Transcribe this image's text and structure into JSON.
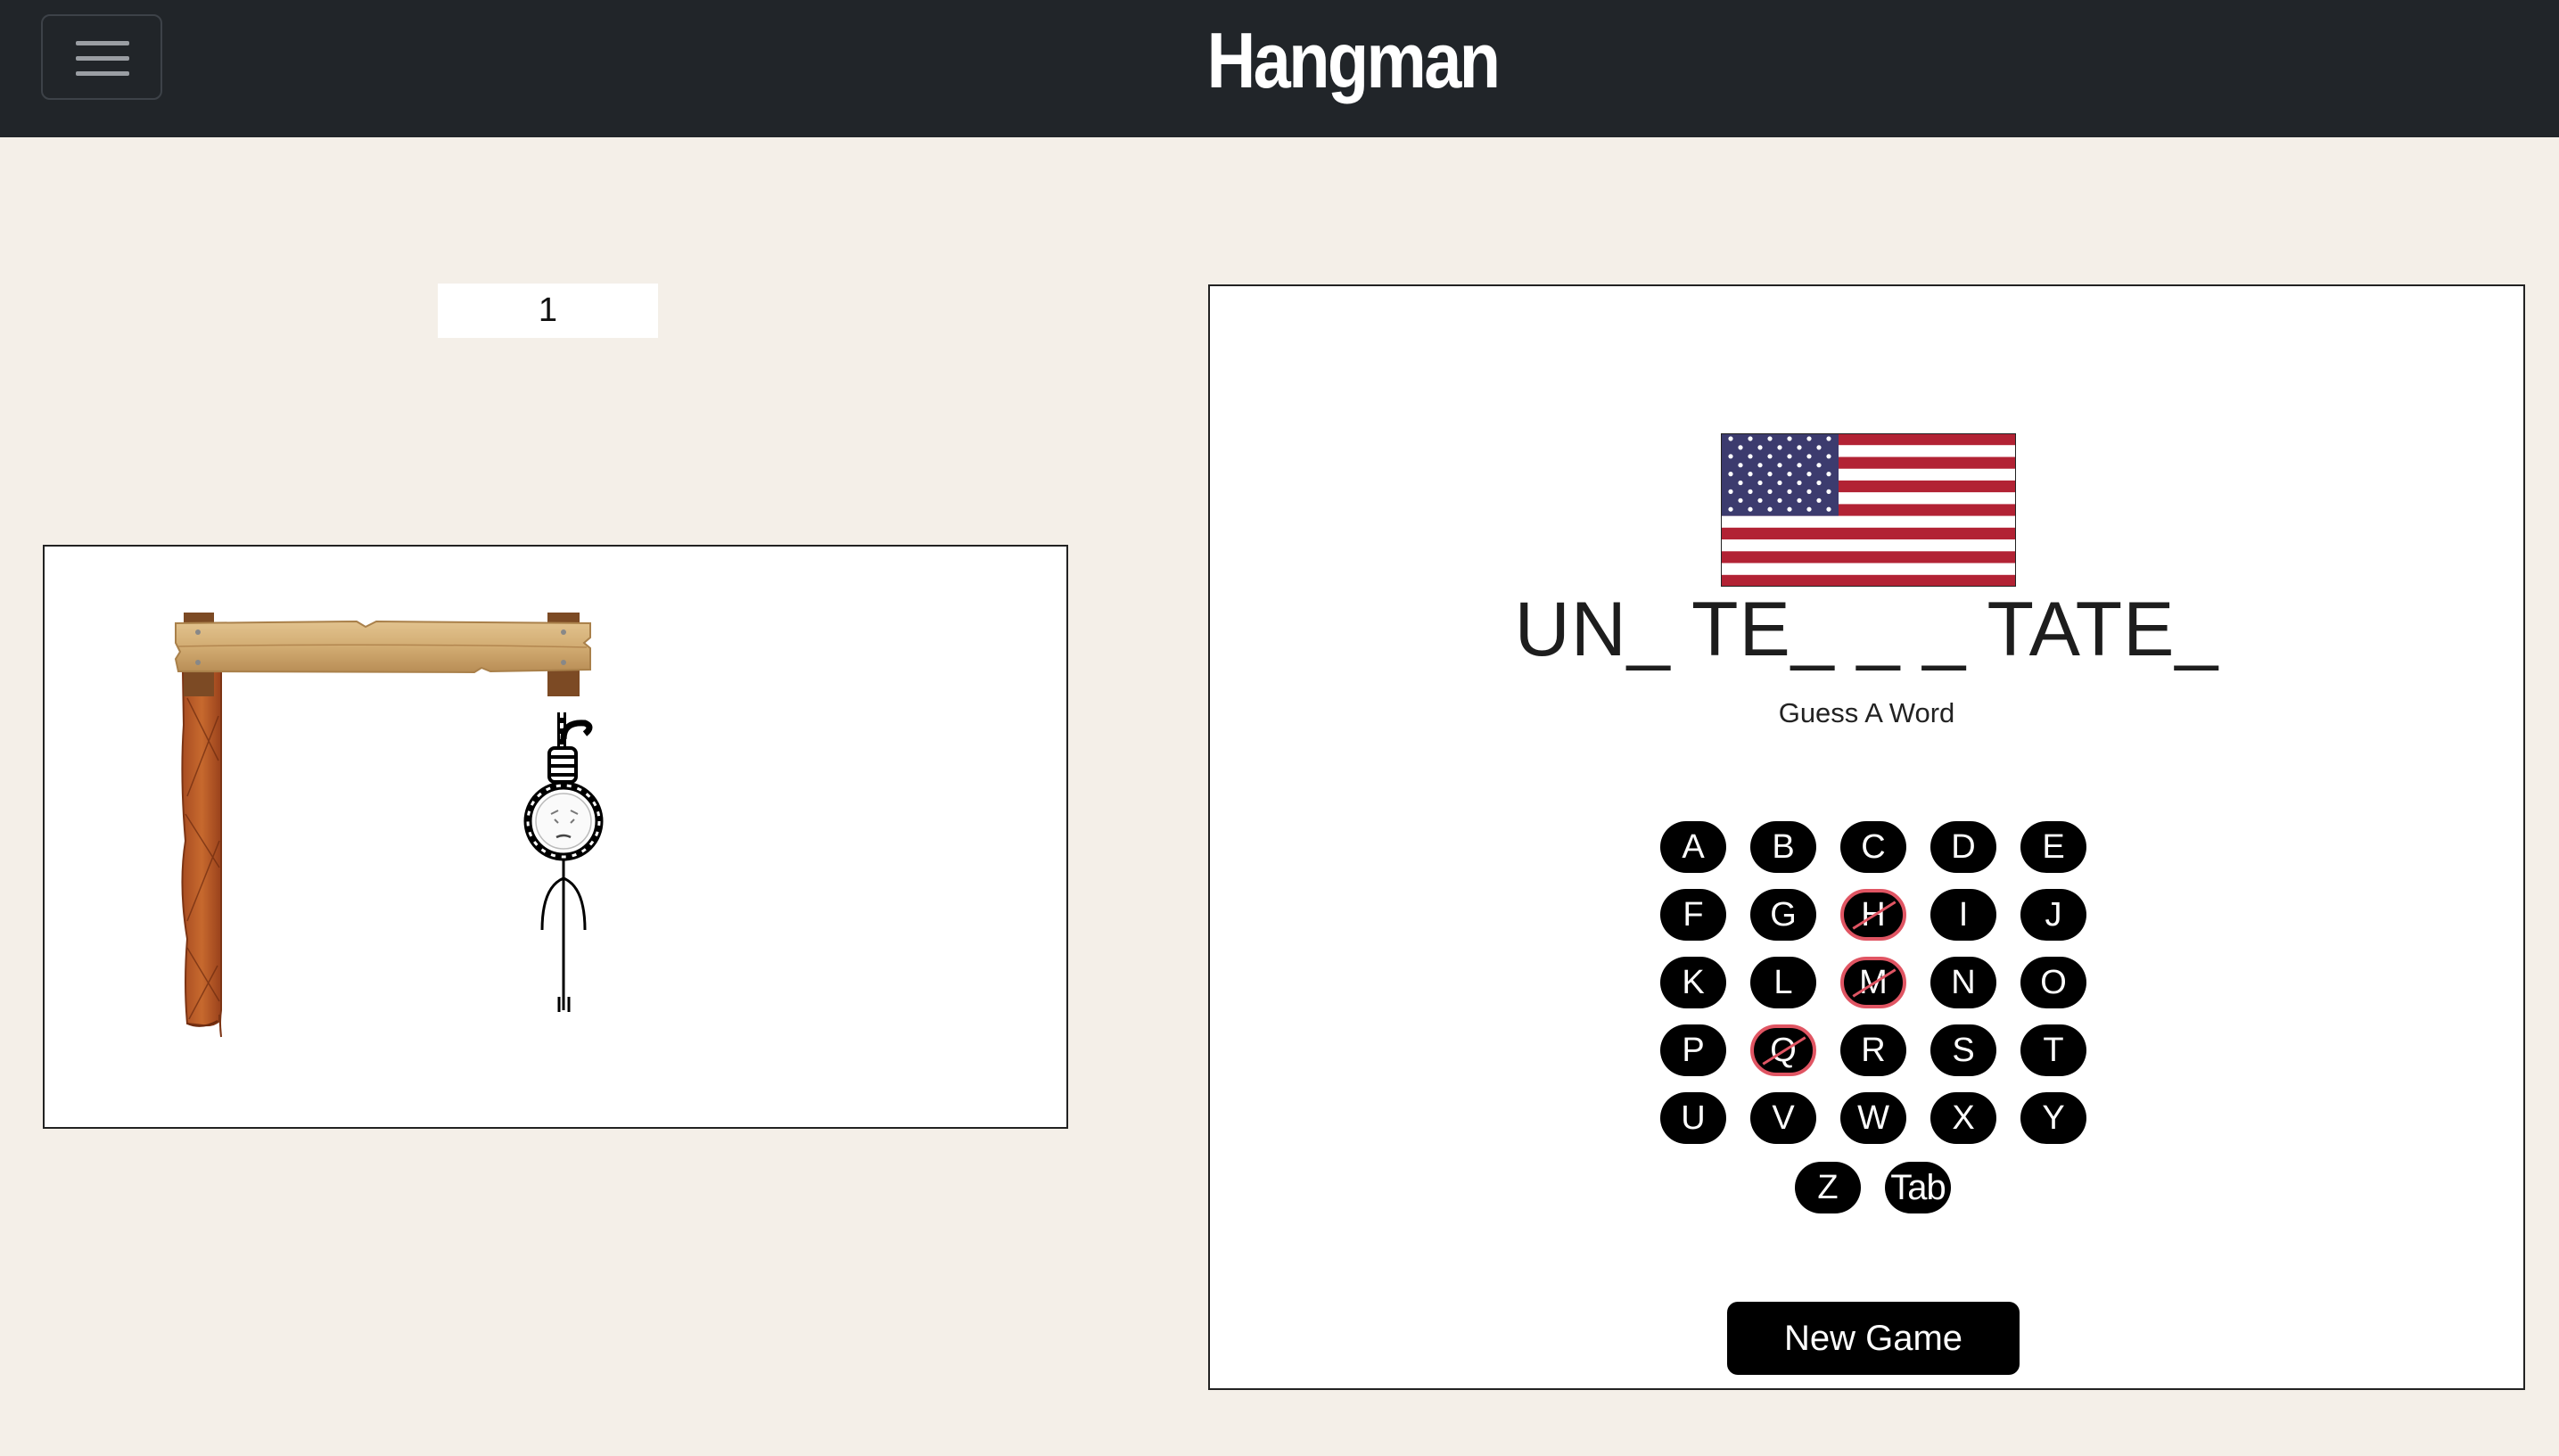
{
  "header": {
    "title": "Hangman",
    "menu_icon": "hamburger-menu-icon"
  },
  "game": {
    "wrong_guesses": "1",
    "word_display": "UN_ TE_ _ _ TATE_",
    "hint": "Guess A Word",
    "hint_image": "us-flag-icon",
    "new_game_label": "New Game",
    "hangman_parts_shown": [
      "head",
      "body",
      "arms",
      "legs"
    ]
  },
  "keyboard": {
    "keys": [
      {
        "label": "A",
        "used": false
      },
      {
        "label": "B",
        "used": false
      },
      {
        "label": "C",
        "used": false
      },
      {
        "label": "D",
        "used": false
      },
      {
        "label": "E",
        "used": false
      },
      {
        "label": "F",
        "used": false
      },
      {
        "label": "G",
        "used": false
      },
      {
        "label": "H",
        "used": true
      },
      {
        "label": "I",
        "used": false
      },
      {
        "label": "J",
        "used": false
      },
      {
        "label": "K",
        "used": false
      },
      {
        "label": "L",
        "used": false
      },
      {
        "label": "M",
        "used": true
      },
      {
        "label": "N",
        "used": false
      },
      {
        "label": "O",
        "used": false
      },
      {
        "label": "P",
        "used": false
      },
      {
        "label": "Q",
        "used": true
      },
      {
        "label": "R",
        "used": false
      },
      {
        "label": "S",
        "used": false
      },
      {
        "label": "T",
        "used": false
      },
      {
        "label": "U",
        "used": false
      },
      {
        "label": "V",
        "used": false
      },
      {
        "label": "W",
        "used": false
      },
      {
        "label": "X",
        "used": false
      },
      {
        "label": "Y",
        "used": false
      },
      {
        "label": "Z",
        "used": false
      },
      {
        "label": "Tab",
        "used": false
      }
    ]
  },
  "colors": {
    "navbar": "#212529",
    "background": "#f4efe8",
    "key": "#000000",
    "used_key_strike": "#e05563",
    "flag_red": "#b22234",
    "flag_blue": "#3c3b6e",
    "wood": "#c5935a"
  }
}
